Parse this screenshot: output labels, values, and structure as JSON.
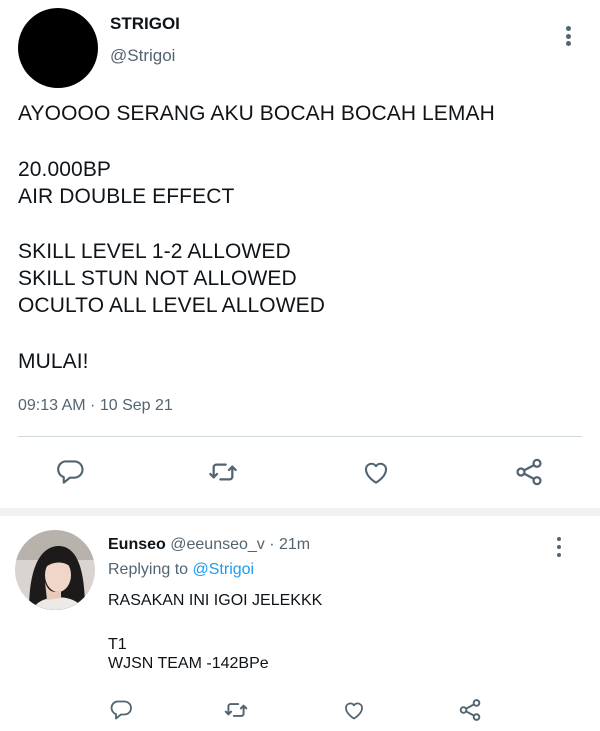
{
  "tweet": {
    "display_name": "STRIGOI",
    "handle": "@Strigoi",
    "lines": [
      "AYOOOO SERANG AKU BOCAH BOCAH LEMAH",
      "20.000BP",
      "AIR DOUBLE EFFECT",
      "SKILL LEVEL 1-2 ALLOWED",
      "SKILL STUN NOT ALLOWED",
      "OCULTO ALL LEVEL ALLOWED",
      "MULAI!"
    ],
    "timestamp": "09:13 AM · 10 Sep 21",
    "actions": [
      "reply-icon",
      "retweet-icon",
      "like-icon",
      "share-icon"
    ]
  },
  "reply": {
    "display_name": "Eunseo",
    "handle": "@eeunseo_v",
    "time": "· 21m",
    "replying_prefix": "Replying to",
    "replying_to": "@Strigoi",
    "lines": [
      "RASAKAN INI IGOI JELEKKK",
      "T1",
      "WJSN TEAM -142BPe"
    ]
  },
  "colors": {
    "text": "#0f1419",
    "secondary": "#536471",
    "accent": "#1d9bf0",
    "divider": "#cfd9de"
  }
}
